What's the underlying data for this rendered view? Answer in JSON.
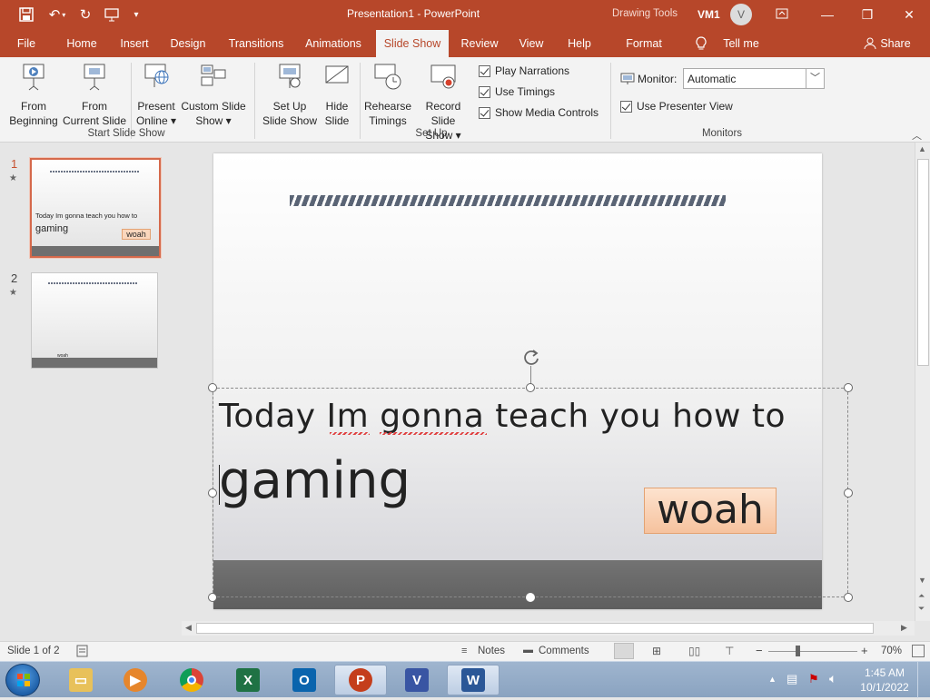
{
  "titlebar": {
    "title": "Presentation1  -  PowerPoint",
    "context_tab": "Drawing Tools",
    "user": "VM1",
    "avatar_letter": "V"
  },
  "tabs": [
    "File",
    "Home",
    "Insert",
    "Design",
    "Transitions",
    "Animations",
    "Slide Show",
    "Review",
    "View",
    "Help",
    "Format",
    "Tell me",
    "Share"
  ],
  "ribbon": {
    "from_beginning": [
      "From",
      "Beginning"
    ],
    "from_current": [
      "From",
      "Current Slide"
    ],
    "present_online": [
      "Present",
      "Online ▾"
    ],
    "custom_show": [
      "Custom Slide",
      "Show ▾"
    ],
    "group_start": "Start Slide Show",
    "setup_show": [
      "Set Up",
      "Slide Show"
    ],
    "hide_slide": [
      "Hide",
      "Slide"
    ],
    "rehearse": [
      "Rehearse",
      "Timings"
    ],
    "record": [
      "Record Slide",
      "Show ▾"
    ],
    "play_narrations": "Play Narrations",
    "use_timings": "Use Timings",
    "show_media": "Show Media Controls",
    "group_setup": "Set Up",
    "monitor_label": "Monitor:",
    "monitor_value": "Automatic",
    "presenter_view": "Use Presenter View",
    "group_monitors": "Monitors"
  },
  "thumbnails": [
    {
      "num": "1",
      "text": "Today Im gonna teach you how to",
      "text2": "gaming",
      "box": "woah"
    },
    {
      "num": "2",
      "box": "woah"
    }
  ],
  "slide": {
    "line1": "Today Im gonna teach you how to",
    "line2": "gaming",
    "box": "woah"
  },
  "status": {
    "slide_of": "Slide 1 of 2",
    "notes": "Notes",
    "comments": "Comments",
    "minus": "−",
    "plus": "+",
    "zoom": "70%"
  },
  "taskbar": {
    "time": "1:45 AM",
    "date": "10/1/2022"
  },
  "colors": {
    "accent": "#b7472a",
    "selection": "#d5694b"
  }
}
